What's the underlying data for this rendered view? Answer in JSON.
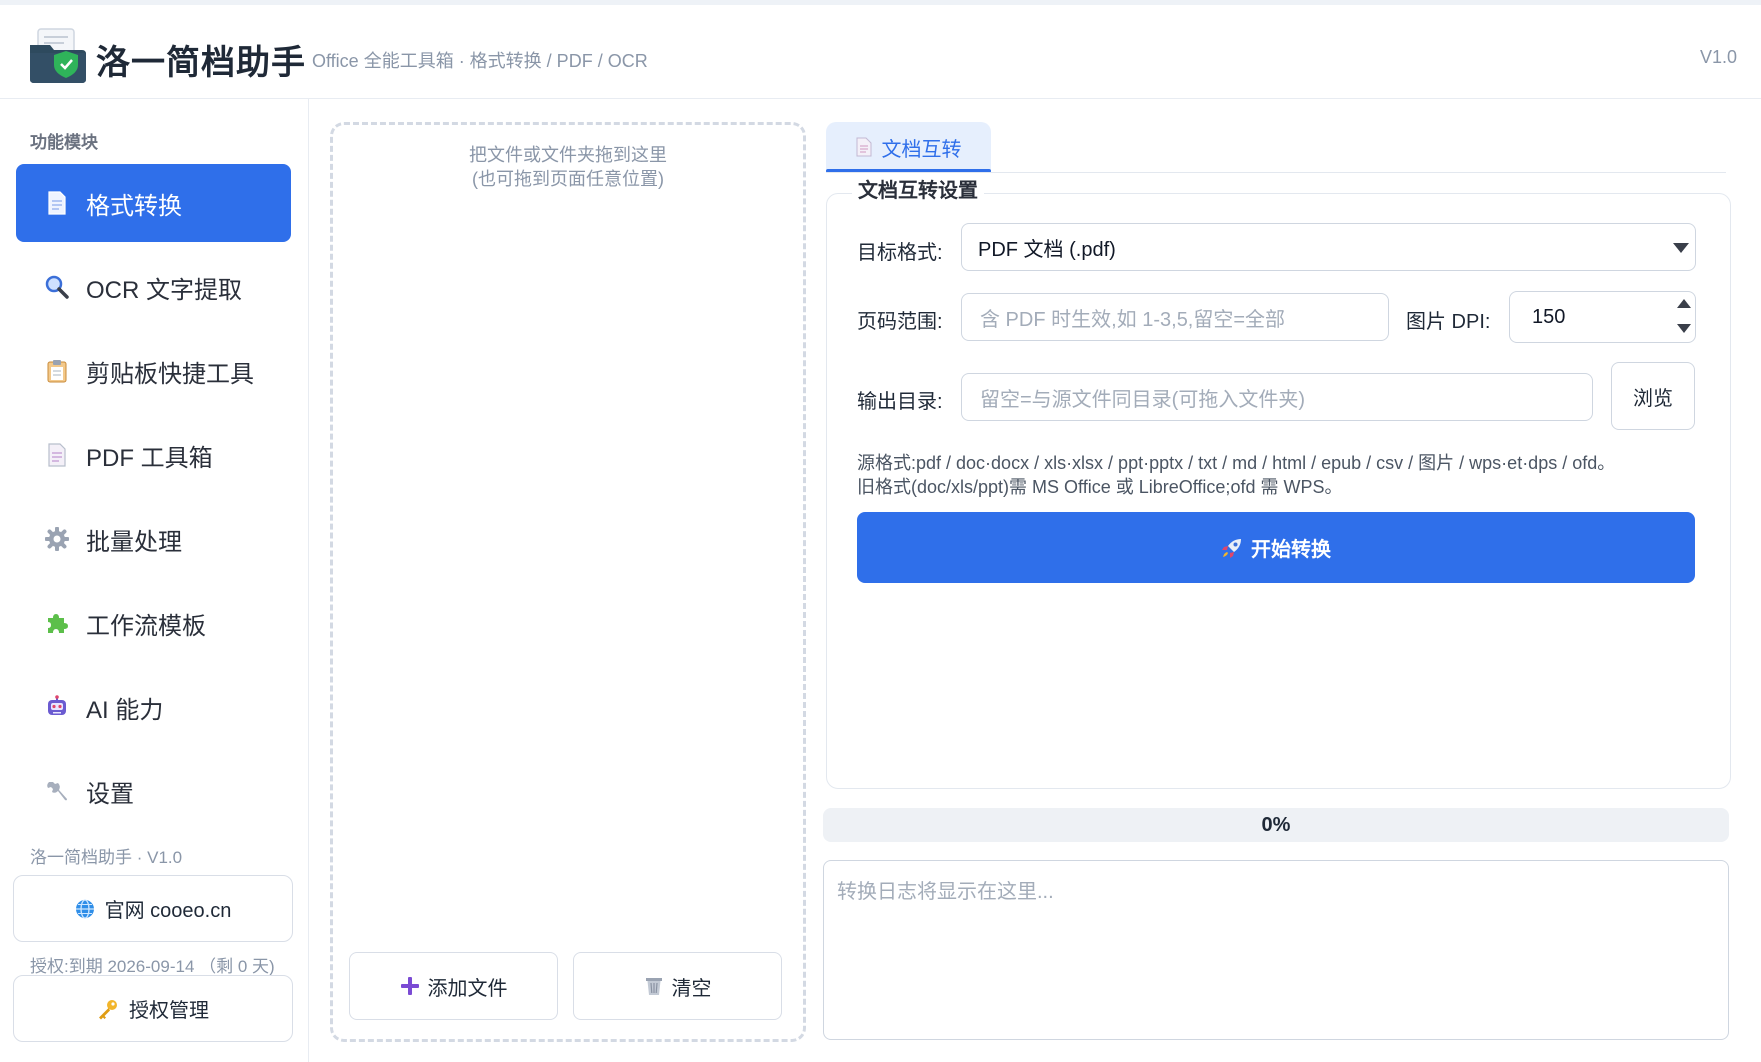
{
  "app": {
    "title": "洛一简档助手",
    "subtitle": "Office 全能工具箱 · 格式转换 / PDF / OCR",
    "version": "V1.0"
  },
  "sidebar": {
    "section_title": "功能模块",
    "items": [
      {
        "label": "格式转换",
        "icon": "document-icon",
        "active": true
      },
      {
        "label": "OCR 文字提取",
        "icon": "magnifier-icon",
        "active": false
      },
      {
        "label": "剪贴板快捷工具",
        "icon": "clipboard-icon",
        "active": false
      },
      {
        "label": "PDF 工具箱",
        "icon": "pdf-document-icon",
        "active": false
      },
      {
        "label": "批量处理",
        "icon": "gear-icon",
        "active": false
      },
      {
        "label": "工作流模板",
        "icon": "puzzle-icon",
        "active": false
      },
      {
        "label": "AI 能力",
        "icon": "robot-icon",
        "active": false
      },
      {
        "label": "设置",
        "icon": "wrench-icon",
        "active": false
      }
    ],
    "footer_text": "洛一简档助手 · V1.0",
    "website_button": "官网 cooeo.cn",
    "license_text": "授权:到期 2026-09-14 （剩 0 天)",
    "license_button": "授权管理"
  },
  "dropzone": {
    "hint_line1": "把文件或文件夹拖到这里",
    "hint_line2": "(也可拖到页面任意位置)",
    "add_button": "添加文件",
    "clear_button": "清空"
  },
  "tabs": [
    {
      "label": "文档互转",
      "icon": "document-icon",
      "active": true
    }
  ],
  "settings": {
    "title": "文档互转设置",
    "target_format_label": "目标格式:",
    "target_format_value": "PDF 文档 (.pdf)",
    "page_range_label": "页码范围:",
    "page_range_placeholder": "含 PDF 时生效,如 1-3,5,留空=全部",
    "dpi_label": "图片 DPI:",
    "dpi_value": "150",
    "output_dir_label": "输出目录:",
    "output_dir_placeholder": "留空=与源文件同目录(可拖入文件夹)",
    "browse_button": "浏览",
    "hint_line1": "源格式:pdf / doc·docx / xls·xlsx / ppt·pptx / txt / md / html / epub / csv / 图片 / wps·et·dps / ofd。",
    "hint_line2": "旧格式(doc/xls/ppt)需 MS Office 或 LibreOffice;ofd 需 WPS。",
    "start_button": "开始转换"
  },
  "progress": {
    "value": 0,
    "label": "0%"
  },
  "log": {
    "placeholder": "转换日志将显示在这里..."
  },
  "colors": {
    "accent": "#2f6fea",
    "tab_bg": "#e6effd",
    "border": "#cfd6e0",
    "muted_text": "#8a96a8"
  }
}
